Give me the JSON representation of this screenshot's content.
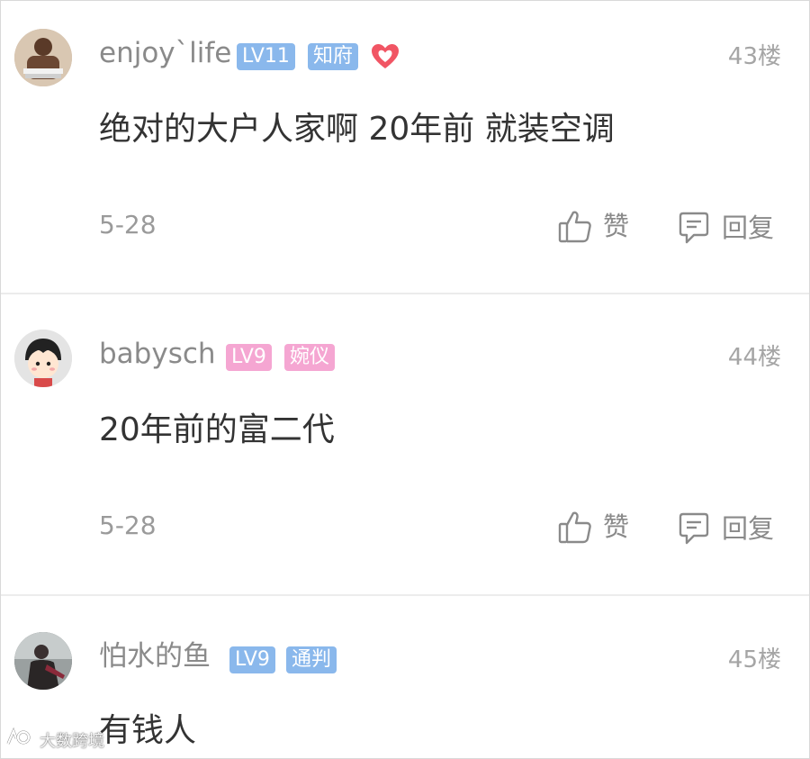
{
  "comments": [
    {
      "username": "enjoy`life",
      "level": "LV11",
      "title": "知府",
      "has_heart": true,
      "floor": "43楼",
      "content": "绝对的大户人家啊 20年前 就装空调",
      "date": "5-28",
      "like_label": "赞",
      "reply_label": "回复"
    },
    {
      "username": "babysch",
      "level": "LV9",
      "title": "婉仪",
      "floor": "44楼",
      "content": "20年前的富二代",
      "date": "5-28",
      "like_label": "赞",
      "reply_label": "回复"
    },
    {
      "username": "怕水的鱼",
      "level": "LV9",
      "title": "通判",
      "floor": "45楼",
      "content": "有钱人"
    }
  ],
  "colors": {
    "badge_blue": "#8ab8ec",
    "badge_pink": "#f5a6d2",
    "heart_red": "#f15564"
  },
  "watermark": "大数跨境"
}
